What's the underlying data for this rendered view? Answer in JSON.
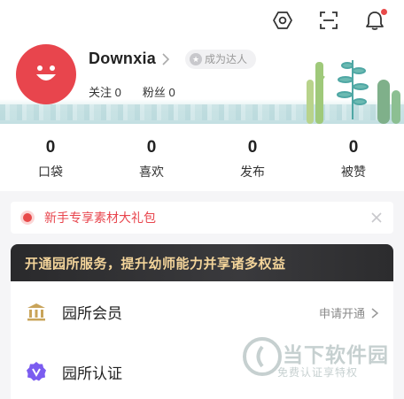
{
  "profile": {
    "username": "Downxia",
    "badge_label": "成为达人",
    "following_label": "关注",
    "following_count": "0",
    "followers_label": "粉丝",
    "followers_count": "0"
  },
  "top_icons": [
    "settings-icon",
    "scan-icon",
    "notification-icon"
  ],
  "stats": [
    {
      "value": "0",
      "label": "口袋"
    },
    {
      "value": "0",
      "label": "喜欢"
    },
    {
      "value": "0",
      "label": "发布"
    },
    {
      "value": "0",
      "label": "被赞"
    }
  ],
  "notice": {
    "text": "新手专享素材大礼包"
  },
  "banner": {
    "text": "开通园所服务，提升幼师能力并享诸多权益"
  },
  "menu": [
    {
      "label": "园所会员",
      "action": "申请开通",
      "icon": "institution-icon"
    },
    {
      "label": "园所认证",
      "icon": "verified-icon"
    }
  ],
  "watermark": {
    "title": "当下软件园",
    "subtitle": "免费认证享特权"
  },
  "colors": {
    "accent": "#e8454d",
    "banner_bg": "#2c2c2e",
    "banner_text": "#f3d49a",
    "verify_purple": "#7b5cf0",
    "gold": "#c9a45a"
  }
}
